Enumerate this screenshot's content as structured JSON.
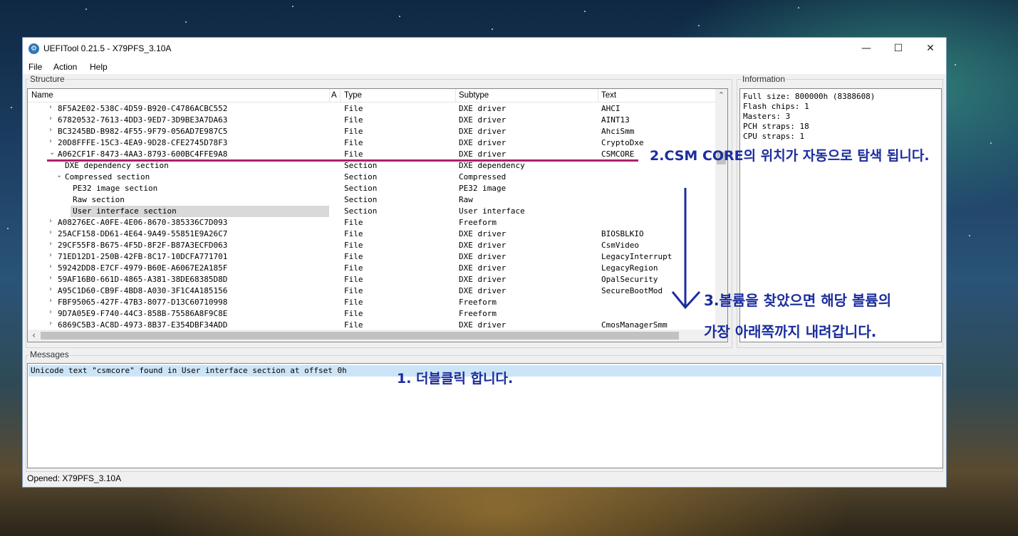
{
  "window": {
    "title": "UEFITool 0.21.5 - X79PFS_3.10A",
    "minimize": "—",
    "maximize": "☐",
    "close": "✕",
    "menu": [
      "File",
      "Action",
      "Help"
    ]
  },
  "structure": {
    "label": "Structure",
    "columns": [
      "Name",
      "A",
      "Type",
      "Subtype",
      "Text"
    ],
    "rows": [
      {
        "name": "8F5A2E02-538C-4D59-B920-C4786ACBC552",
        "type": "File",
        "subtype": "DXE driver",
        "text": "AHCI",
        "arrow": "›"
      },
      {
        "name": "67820532-7613-4DD3-9ED7-3D9BE3A7DA63",
        "type": "File",
        "subtype": "DXE driver",
        "text": "AINT13",
        "arrow": "›"
      },
      {
        "name": "BC3245BD-B982-4F55-9F79-056AD7E987C5",
        "type": "File",
        "subtype": "DXE driver",
        "text": "AhciSmm",
        "arrow": "›"
      },
      {
        "name": "20D8FFFE-15C3-4EA9-9D28-CFE2745D78F3",
        "type": "File",
        "subtype": "DXE driver",
        "text": "CryptoDxe",
        "arrow": "›"
      },
      {
        "name": "A062CF1F-8473-4AA3-8793-600BC4FFE9A8",
        "type": "File",
        "subtype": "DXE driver",
        "text": "CSMCORE",
        "arrow": "⌄"
      },
      {
        "name": "DXE dependency section",
        "type": "Section",
        "subtype": "DXE dependency",
        "text": "",
        "arrow": ""
      },
      {
        "name": "Compressed section",
        "type": "Section",
        "subtype": "Compressed",
        "text": "",
        "arrow": "⌄"
      },
      {
        "name": "PE32 image section",
        "type": "Section",
        "subtype": "PE32 image",
        "text": "",
        "arrow": ""
      },
      {
        "name": "Raw section",
        "type": "Section",
        "subtype": "Raw",
        "text": "",
        "arrow": ""
      },
      {
        "name": "User interface section",
        "type": "Section",
        "subtype": "User interface",
        "text": "",
        "arrow": ""
      },
      {
        "name": "A08276EC-A0FE-4E06-8670-385336C7D093",
        "type": "File",
        "subtype": "Freeform",
        "text": "",
        "arrow": "›"
      },
      {
        "name": "25ACF158-DD61-4E64-9A49-55851E9A26C7",
        "type": "File",
        "subtype": "DXE driver",
        "text": "BIOSBLKIO",
        "arrow": "›"
      },
      {
        "name": "29CF55F8-B675-4F5D-8F2F-B87A3ECFD063",
        "type": "File",
        "subtype": "DXE driver",
        "text": "CsmVideo",
        "arrow": "›"
      },
      {
        "name": "71ED12D1-250B-42FB-8C17-10DCFA771701",
        "type": "File",
        "subtype": "DXE driver",
        "text": "LegacyInterrupt",
        "arrow": "›"
      },
      {
        "name": "59242DD8-E7CF-4979-B60E-A6067E2A185F",
        "type": "File",
        "subtype": "DXE driver",
        "text": "LegacyRegion",
        "arrow": "›"
      },
      {
        "name": "59AF16B0-661D-4865-A381-38DE68385D8D",
        "type": "File",
        "subtype": "DXE driver",
        "text": "OpalSecurity",
        "arrow": "›"
      },
      {
        "name": "A95C1D60-CB9F-4BD8-A030-3F1C4A185156",
        "type": "File",
        "subtype": "DXE driver",
        "text": "SecureBootMod",
        "arrow": "›"
      },
      {
        "name": "FBF95065-427F-47B3-8077-D13C60710998",
        "type": "File",
        "subtype": "Freeform",
        "text": "",
        "arrow": "›"
      },
      {
        "name": "9D7A05E9-F740-44C3-858B-75586A8F9C8E",
        "type": "File",
        "subtype": "Freeform",
        "text": "",
        "arrow": "›"
      },
      {
        "name": "6869C5B3-AC8D-4973-8B37-E354DBF34ADD",
        "type": "File",
        "subtype": "DXE driver",
        "text": "CmosManagerSmm",
        "arrow": "›"
      }
    ],
    "selected_index": 9,
    "scroll_up": "⌃",
    "scroll_left": "‹"
  },
  "information": {
    "label": "Information",
    "lines": [
      "Full size: 800000h (8388608)",
      "Flash chips: 1",
      "Masters: 3",
      "PCH straps: 18",
      "CPU straps: 1"
    ]
  },
  "messages": {
    "label": "Messages",
    "items": [
      "Unicode text \"csmcore\" found in User interface section at offset 0h"
    ]
  },
  "status": "Opened: X79PFS_3.10A",
  "annotations": {
    "step1": "1. 더블클릭 합니다.",
    "step2": "2.CSM CORE의 위치가 자동으로 탐색 됩니다.",
    "step3_line1": "3.볼륨을 찾았으면 해당 볼륨의",
    "step3_line2": "가장 아래쪽까지 내려갑니다.",
    "color": "#1b2d9e",
    "underline_color": "#b0206a"
  }
}
